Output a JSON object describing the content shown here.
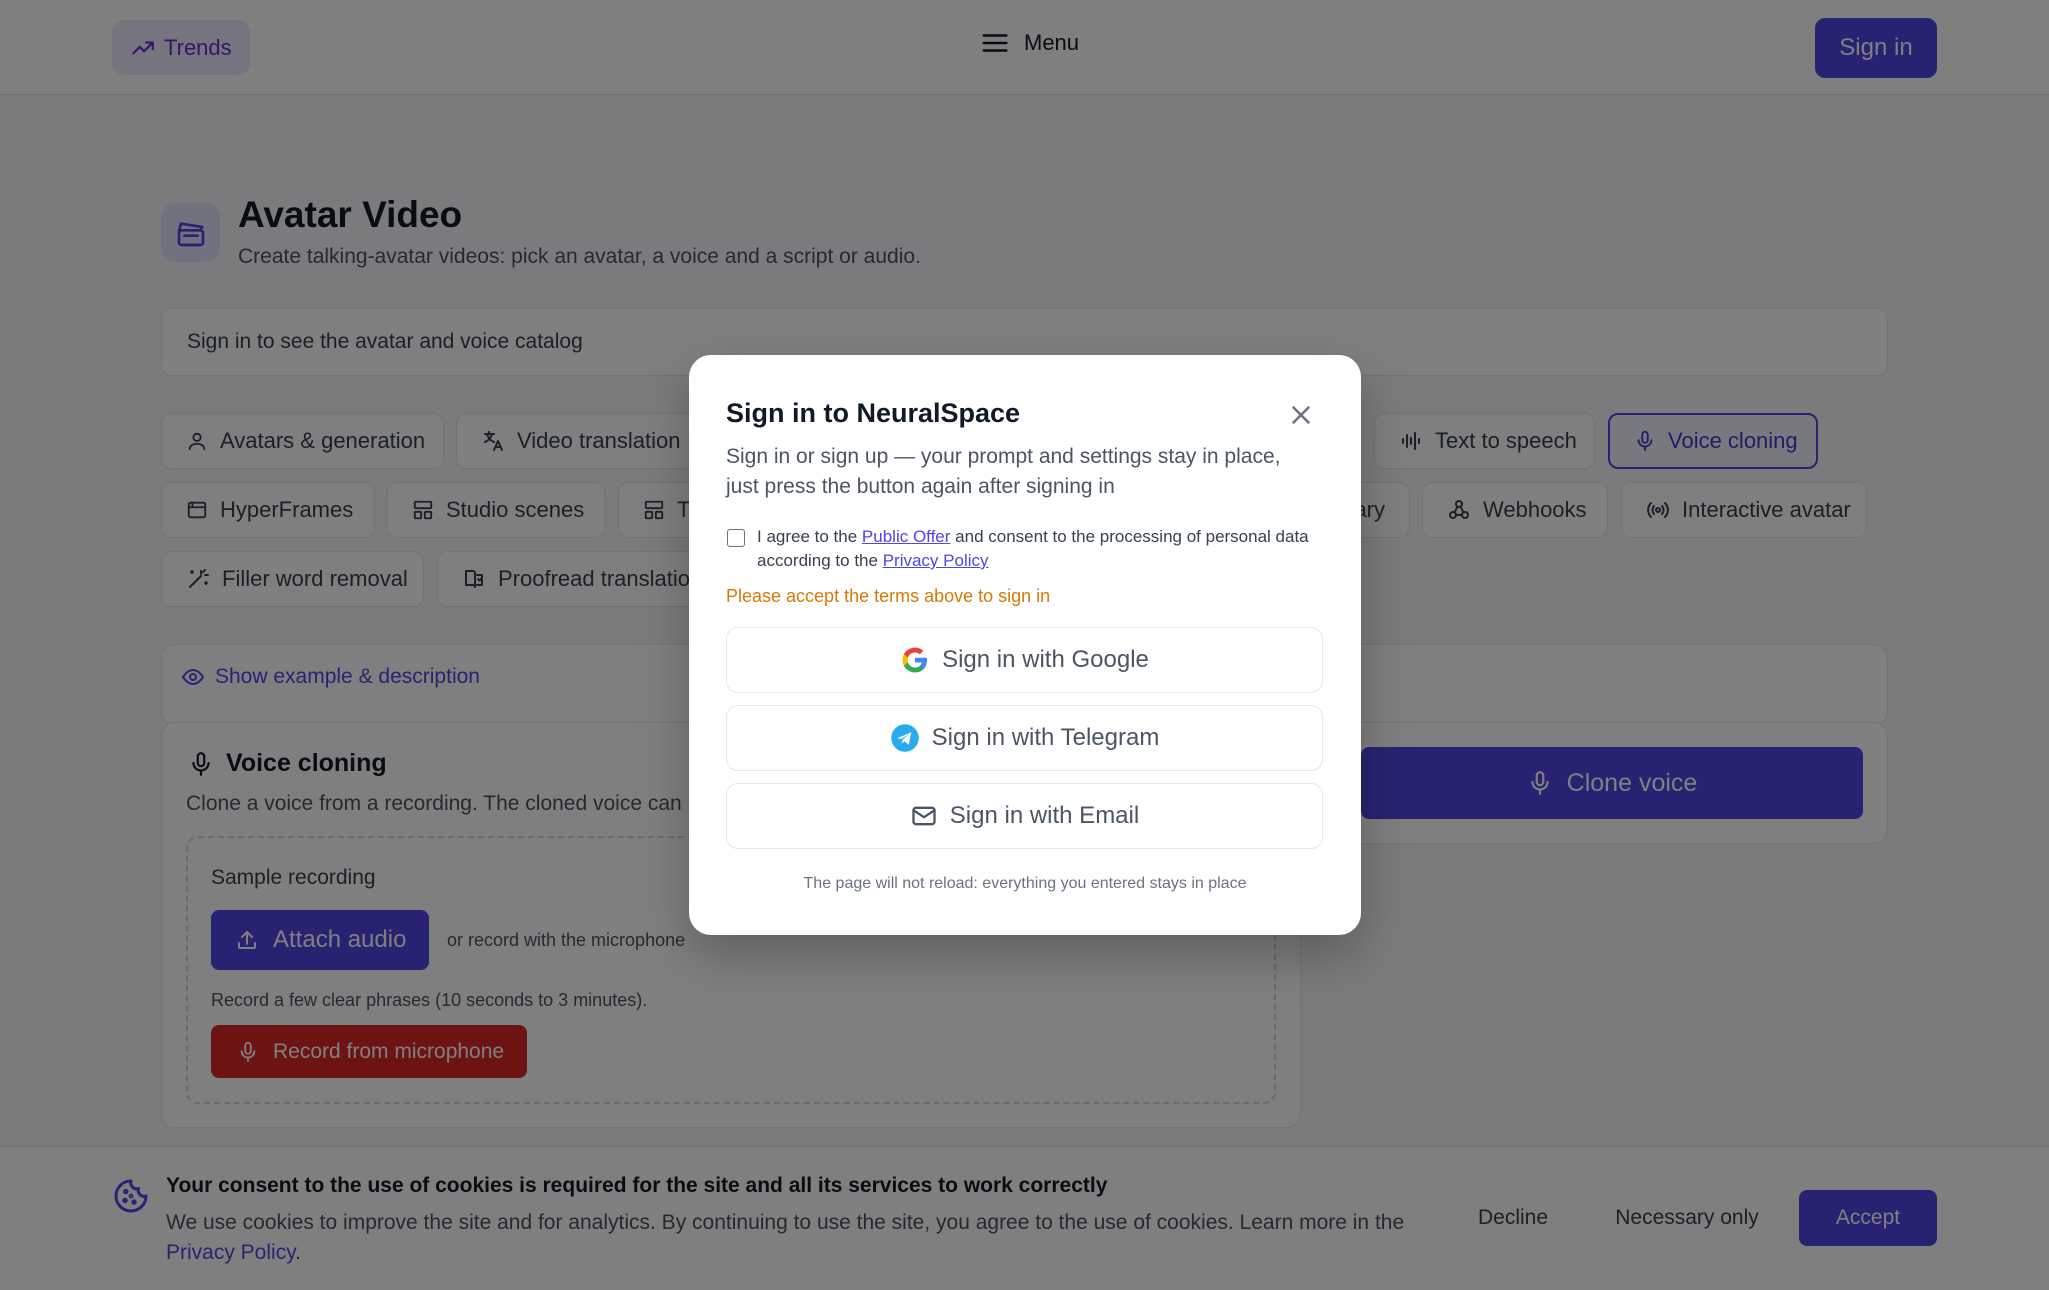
{
  "header": {
    "trends_label": "Trends",
    "menu_label": "Menu",
    "signin_label": "Sign in"
  },
  "page": {
    "title": "Avatar Video",
    "subtitle": "Create talking-avatar videos: pick an avatar, a voice and a script or audio.",
    "catalog_notice": "Sign in to see the avatar and voice catalog"
  },
  "tabs": [
    {
      "label": "Avatars & generation",
      "icon": "user-icon"
    },
    {
      "label": "Video translation",
      "icon": "translate-icon"
    },
    {
      "label": "Text to speech",
      "icon": "waveform-icon"
    },
    {
      "label": "Voice cloning",
      "icon": "mic-icon",
      "selected": true
    },
    {
      "label": "HyperFrames",
      "icon": "window-icon"
    },
    {
      "label": "Studio scenes",
      "icon": "layout-icon"
    },
    {
      "label": "T",
      "icon": "layout-icon"
    },
    {
      "label": "ary",
      "icon": ""
    },
    {
      "label": "Webhooks",
      "icon": "webhook-icon"
    },
    {
      "label": "Interactive avatar",
      "icon": "broadcast-icon"
    },
    {
      "label": "Filler word removal",
      "icon": "wand-icon"
    },
    {
      "label": "Proofread translation",
      "icon": "book-icon"
    }
  ],
  "example": {
    "show_label": "Show example & description"
  },
  "voice_cloning": {
    "title": "Voice cloning",
    "description": "Clone a voice from a recording. The cloned voice can",
    "sample_label": "Sample recording",
    "attach_label": "Attach audio",
    "or_record": "or record with the microphone",
    "hint": "Record a few clear phrases (10 seconds to 3 minutes).",
    "record_label": "Record from microphone",
    "clone_label": "Clone voice"
  },
  "cookie": {
    "title": "Your consent to the use of cookies is required for the site and all its services to work correctly",
    "text": "We use cookies to improve the site and for analytics. By continuing to use the site, you agree to the use of cookies. Learn more in the",
    "link": "Privacy Policy",
    "period": ".",
    "decline": "Decline",
    "necessary": "Necessary only",
    "accept": "Accept"
  },
  "modal": {
    "title": "Sign in to NeuralSpace",
    "subtitle": "Sign in or sign up — your prompt and settings stay in place, just press the button again after signing in",
    "agree_prefix": "I agree to the",
    "public_offer": "Public Offer",
    "agree_middle": "and consent to the processing of personal data according to the",
    "privacy_policy": "Privacy Policy",
    "warning": "Please accept the terms above to sign in",
    "google": "Sign in with Google",
    "telegram": "Sign in with Telegram",
    "email": "Sign in with Email",
    "note": "The page will not reload: everything you entered stays in place"
  },
  "colors": {
    "accent": "#4f46e5",
    "danger": "#dc2626",
    "warning": "#d97706",
    "telegram": "#2aabee"
  }
}
